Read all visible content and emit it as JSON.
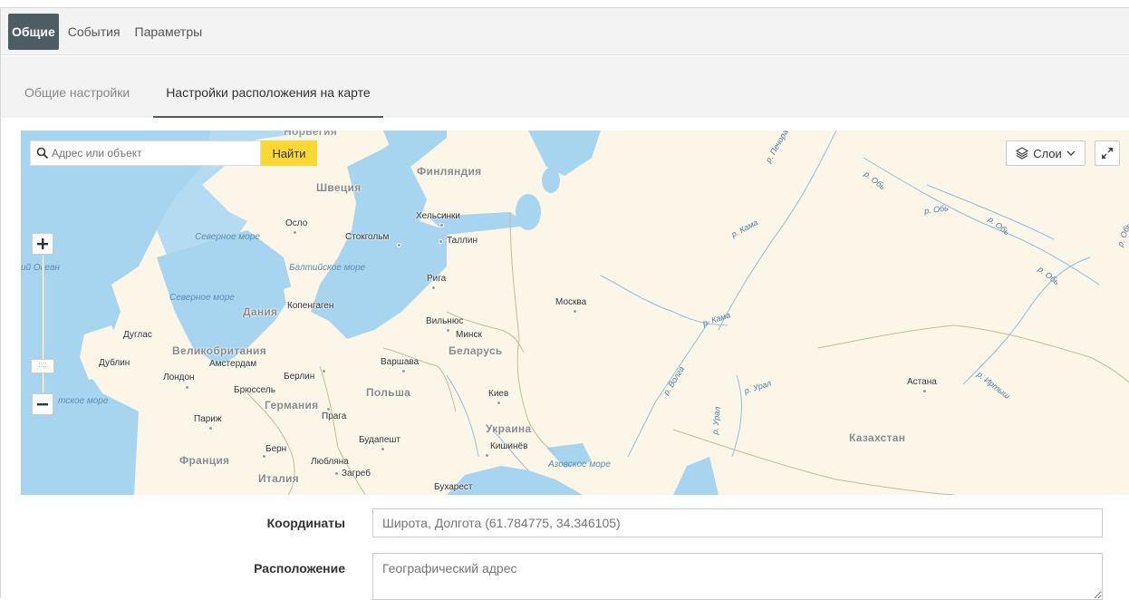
{
  "top_tabs": [
    {
      "label": "Общие",
      "active": true
    },
    {
      "label": "События",
      "active": false
    },
    {
      "label": "Параметры",
      "active": false
    }
  ],
  "sub_tabs": [
    {
      "label": "Общие настройки",
      "active": false
    },
    {
      "label": "Настройки расположения на карте",
      "active": true
    }
  ],
  "map": {
    "search_placeholder": "Адрес или объект",
    "find_label": "Найти",
    "layers_label": "Слои",
    "zoom_handle_glyph": "::::",
    "labels": {
      "finland": "Финляндия",
      "sweden": "Швеция",
      "norway_partial": "Норвегия",
      "helsinki": "Хельсинки",
      "oslo": "Осло",
      "stockholm": "Стокгольм",
      "tallinn": "Таллин",
      "riga": "Рига",
      "copenhagen": "Копенгаген",
      "denmark": "Дания",
      "moscow": "Москва",
      "vilnius": "Вильнюс",
      "minsk": "Минск",
      "belarus": "Беларусь",
      "douglas": "Дуглас",
      "great_britain": "Великобритания",
      "dublin": "Дублин",
      "amsterdam": "Амстердам",
      "london": "Лондон",
      "berlin": "Берлин",
      "warsaw": "Варшава",
      "brussels": "Брюссель",
      "poland": "Польша",
      "kiev": "Киев",
      "germany": "Германия",
      "paris": "Париж",
      "prague": "Прага",
      "ukraine": "Украина",
      "budapest": "Будапешт",
      "chisinau": "Кишинёв",
      "bern": "Берн",
      "france": "Франция",
      "ljubljana": "Любляна",
      "zagreb": "Загреб",
      "italy": "Италия",
      "bucharest": "Бухарест",
      "astana": "Астана",
      "kazakhstan": "Казахстан",
      "north_sea_1": "Северное море",
      "north_sea_2": "Северное море",
      "baltic_sea": "Балтийское море",
      "azov_sea": "Азовское море",
      "ocean_partial": "ий Океан",
      "irish_sea_partial": "тское море",
      "river_pechora": "р. Печора",
      "river_ob_1": "р. Обь",
      "river_ob_2": "р. Обь",
      "river_ob_3": "р. Обь",
      "river_ob_4": "р. Обь",
      "river_ob_5": "р. Обь",
      "river_kama_1": "р. Кама",
      "river_kama_2": "р. Кама",
      "river_volga": "р. Волга",
      "river_ural_1": "р. Урал",
      "river_ural_2": "р. Урал",
      "river_irtysh": "р. Иртыш"
    },
    "colors": {
      "water": "#a7d4ef",
      "land": "#fbf6e7",
      "border": "#c9b99a",
      "find_button": "#fdd835"
    }
  },
  "form": {
    "coords_label": "Координаты",
    "coords_placeholder": "Широта, Долгота (61.784775, 34.346105)",
    "location_label": "Расположение",
    "location_placeholder": "Географический адрес"
  }
}
